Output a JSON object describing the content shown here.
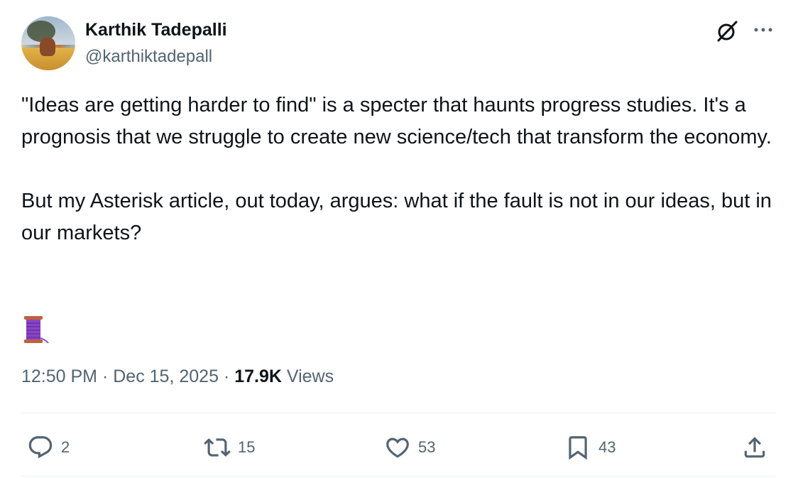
{
  "author": {
    "name": "Karthik Tadepalli",
    "handle": "@karthiktadepall"
  },
  "tweet": {
    "text": "\"Ideas are getting harder to find\" is a specter that haunts progress studies. It's a prognosis that we struggle to create new science/tech that transform the economy.\n\nBut my Asterisk article, out today, argues: what if the fault is not in our ideas, but in our markets?",
    "emoji_icon": "spool-of-thread-icon",
    "time": "12:50 PM",
    "separator": "·",
    "date": "Dec 15, 2025",
    "views_count": "17.9K",
    "views_label": "Views"
  },
  "actions": {
    "replies": "2",
    "retweets": "15",
    "likes": "53",
    "bookmarks": "43"
  },
  "colors": {
    "text": "#0f1419",
    "secondary": "#536471",
    "divider": "#eff3f4",
    "spool": "#8a44c8"
  }
}
